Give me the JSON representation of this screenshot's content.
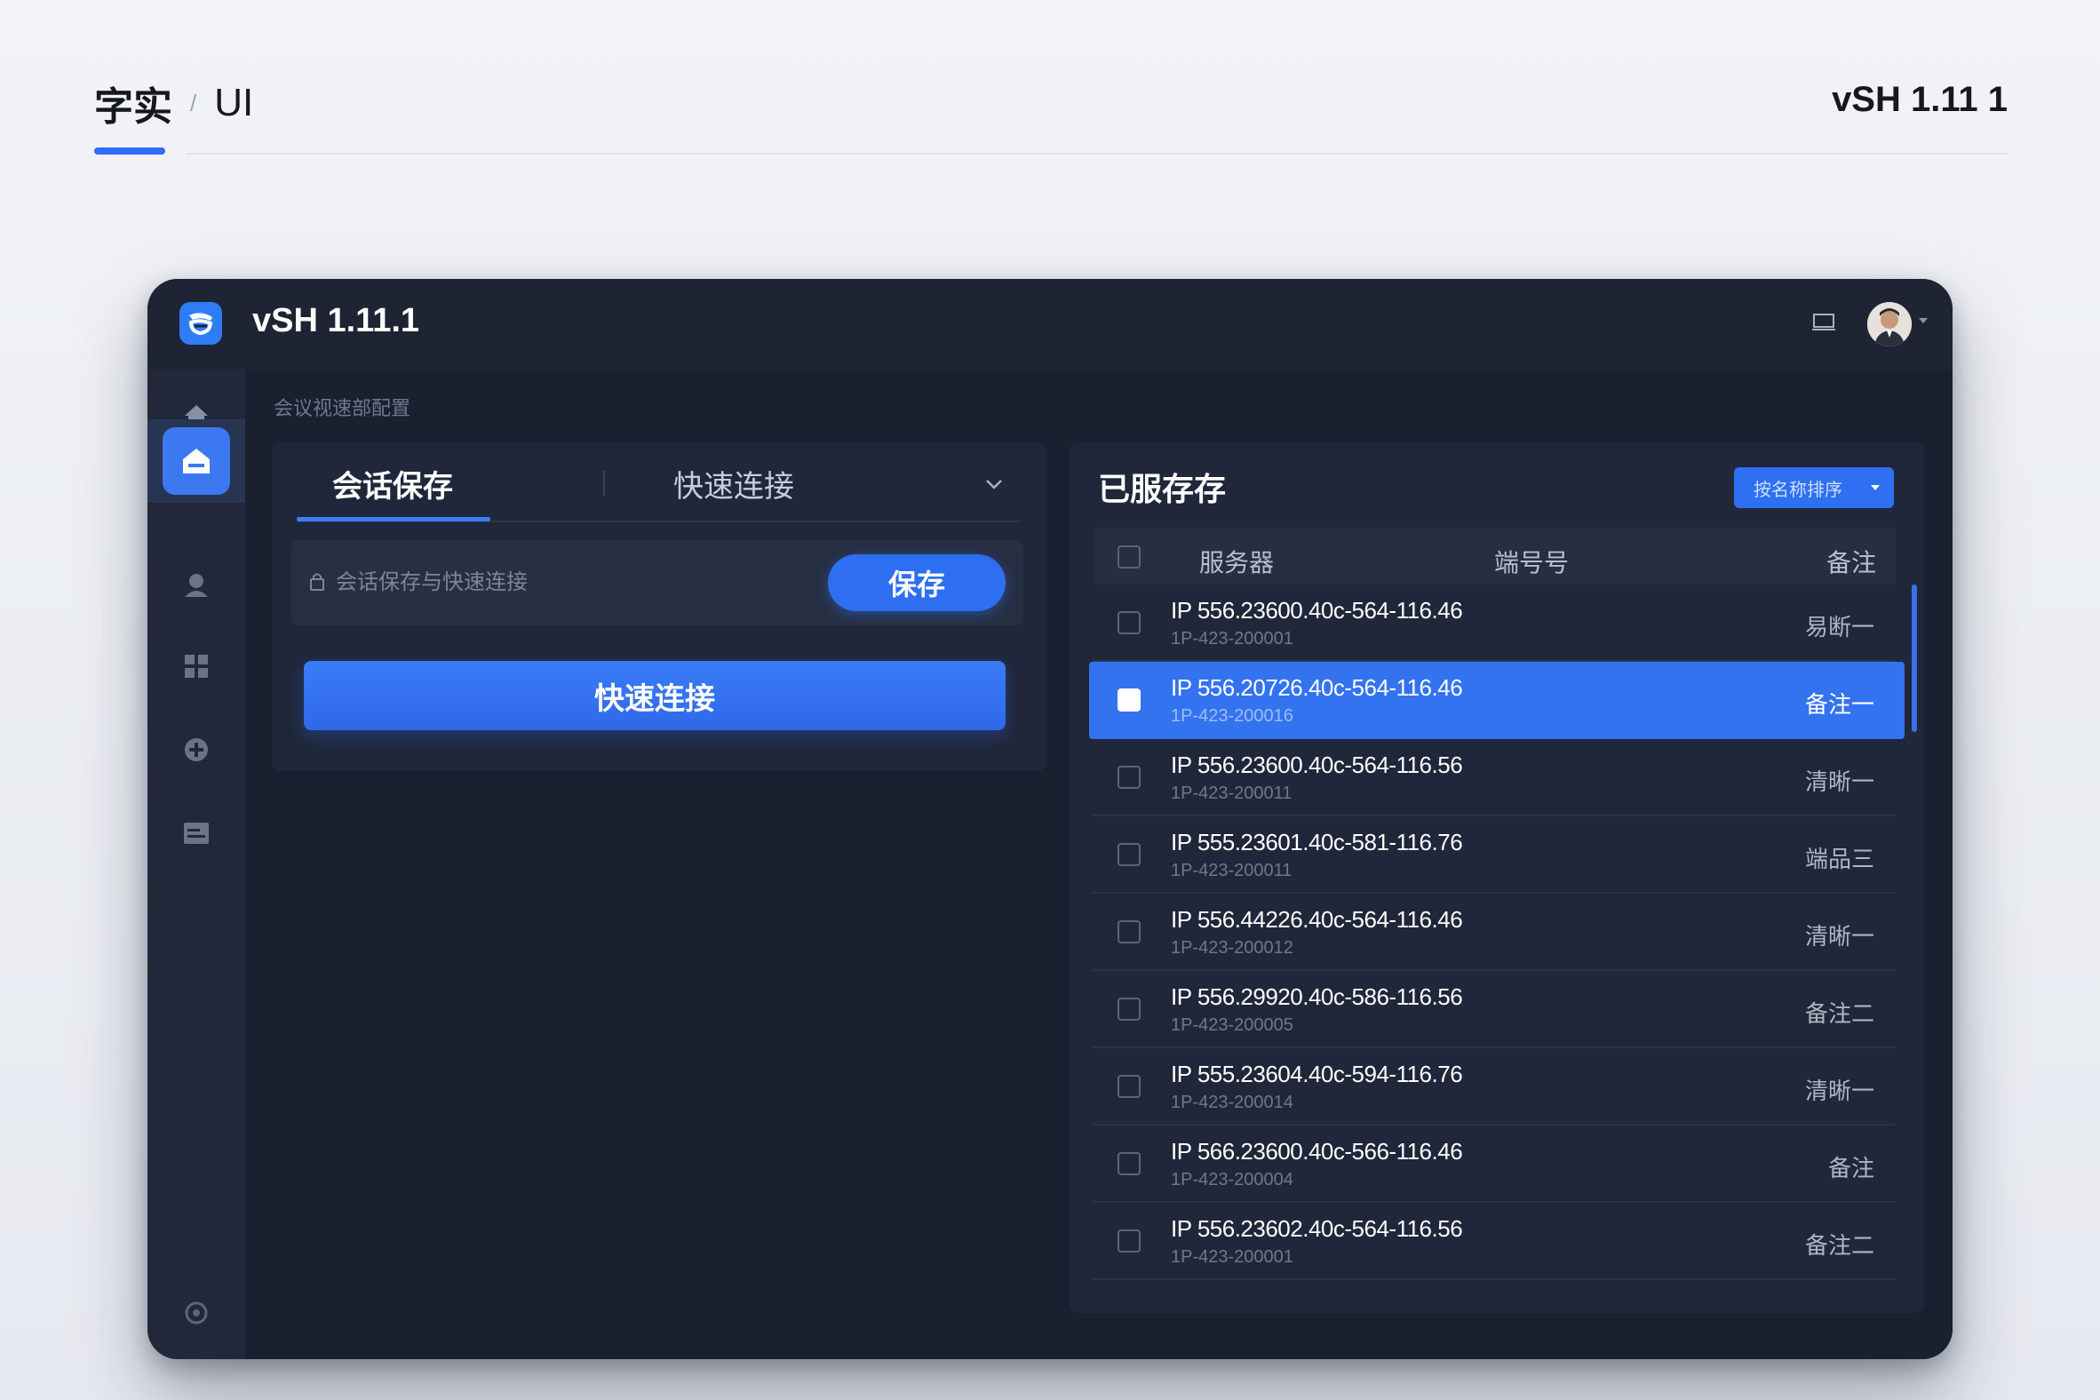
{
  "page": {
    "title": "字实",
    "separator": "/",
    "subtitle": "UI",
    "version": "vSH 1.11 1"
  },
  "app": {
    "title": "vSH 1.11.1",
    "accent_color": "#2f6ff2",
    "titlebar_icons": [
      "screen-icon",
      "avatar",
      "caret-down-icon"
    ]
  },
  "sidebar": {
    "items": [
      {
        "icon": "home-icon"
      },
      {
        "icon": "session-home-icon",
        "active": true
      },
      {
        "icon": "user-icon"
      },
      {
        "icon": "grid-icon"
      },
      {
        "icon": "plugin-icon"
      },
      {
        "icon": "folder-icon"
      }
    ],
    "bottom_icon": "settings-icon"
  },
  "breadcrumb": "会议视速部配置",
  "left_panel": {
    "tabs": [
      {
        "label": "会话保存",
        "active": true
      },
      {
        "label": "快速连接",
        "active": false
      }
    ],
    "input_placeholder": "会话保存与快速连接",
    "save_button": "保存",
    "quick_connect_button": "快速连接"
  },
  "right_panel": {
    "title": "已服存存",
    "sort_label": "按名称排序",
    "columns": {
      "server": "服务器",
      "port": "端号号",
      "note": "备注"
    },
    "rows": [
      {
        "ip": "IP 556.23600.40c-564-116.46",
        "sub": "1P-423-200001",
        "note": "易断一",
        "selected": false
      },
      {
        "ip": "IP 556.20726.40c-564-116.46",
        "sub": "1P-423-200016",
        "note": "备注一",
        "selected": true
      },
      {
        "ip": "IP 556.23600.40c-564-116.56",
        "sub": "1P-423-200011",
        "note": "清晰一",
        "selected": false
      },
      {
        "ip": "IP 555.23601.40c-581-116.76",
        "sub": "1P-423-200011",
        "note": "端品三",
        "selected": false
      },
      {
        "ip": "IP 556.44226.40c-564-116.46",
        "sub": "1P-423-200012",
        "note": "清晰一",
        "selected": false
      },
      {
        "ip": "IP 556.29920.40c-586-116.56",
        "sub": "1P-423-200005",
        "note": "备注二",
        "selected": false
      },
      {
        "ip": "IP 555.23604.40c-594-116.76",
        "sub": "1P-423-200014",
        "note": "清晰一",
        "selected": false
      },
      {
        "ip": "IP 566.23600.40c-566-116.46",
        "sub": "1P-423-200004",
        "note": "备注",
        "selected": false
      },
      {
        "ip": "IP 556.23602.40c-564-116.56",
        "sub": "1P-423-200001",
        "note": "备注二",
        "selected": false
      }
    ]
  }
}
